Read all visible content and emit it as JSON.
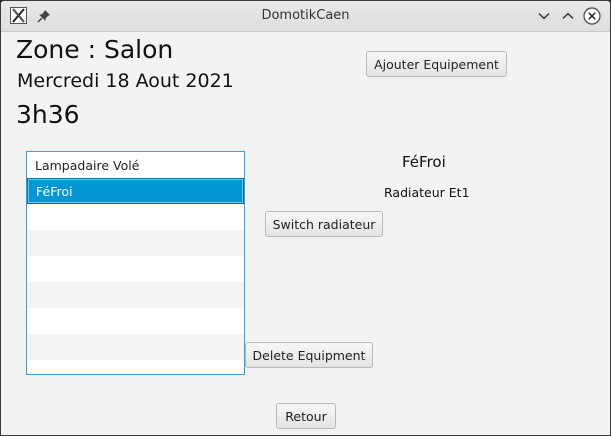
{
  "window": {
    "title": "DomotikCaen"
  },
  "header": {
    "zone_title": "Zone : Salon",
    "date": "Mercredi 18 Aout 2021",
    "time": "3h36"
  },
  "buttons": {
    "add_equipment": "Ajouter Equipement",
    "switch_radiator": "Switch radiateur",
    "delete_equipment": "Delete Equipment",
    "back": "Retour"
  },
  "equipment_list": {
    "items": [
      {
        "label": "Lampadaire Volé",
        "selected": false
      },
      {
        "label": "FéFroi",
        "selected": true
      }
    ]
  },
  "detail": {
    "name": "FéFroi",
    "type": "Radiateur Et1"
  },
  "colors": {
    "selection": "#0396d6",
    "list_border": "#3aa0d0",
    "background": "#f3f3f3"
  }
}
